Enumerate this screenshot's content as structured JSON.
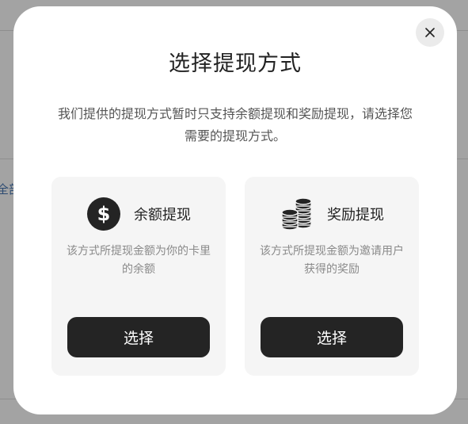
{
  "background": {
    "partial_text": "全部"
  },
  "modal": {
    "title": "选择提现方式",
    "description": "我们提供的提现方式暂时只支持余额提现和奖励提现，请选择您需要的提现方式。",
    "close_icon": "close-icon",
    "options": [
      {
        "icon": "dollar-circle-icon",
        "title": "余额提现",
        "description": "该方式所提现金额为你的卡里的余额",
        "button_label": "选择"
      },
      {
        "icon": "coin-stack-icon",
        "title": "奖励提现",
        "description": "该方式所提现金额为邀请用户获得的奖励",
        "button_label": "选择"
      }
    ]
  },
  "colors": {
    "overlay": "#9d9d9d",
    "modal_bg": "#ffffff",
    "card_bg": "#f5f5f5",
    "button_bg": "#242424",
    "button_text": "#ffffff",
    "title_text": "#222222"
  }
}
